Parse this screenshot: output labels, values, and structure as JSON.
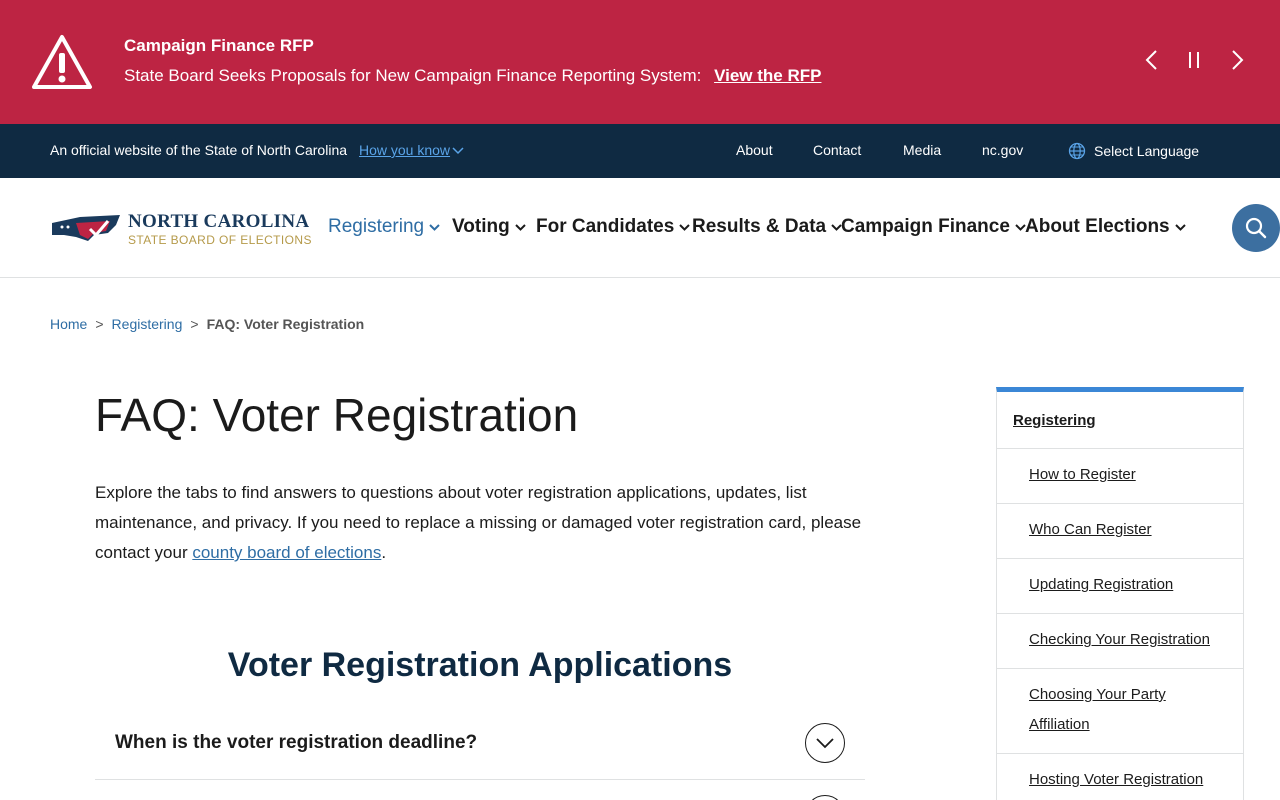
{
  "alert": {
    "title": "Campaign Finance RFP",
    "text": "State Board Seeks Proposals for New Campaign Finance Reporting System:",
    "link": "View the RFP"
  },
  "official_bar": {
    "text": "An official website of the State of North Carolina",
    "how_know": "How you know",
    "links": [
      "About",
      "Contact",
      "Media",
      "nc.gov"
    ],
    "language": "Select Language"
  },
  "header": {
    "logo_name": "NORTH CAROLINA",
    "logo_sub": "STATE BOARD OF ELECTIONS",
    "nav": [
      "Registering",
      "Voting",
      "For Candidates",
      "Results & Data",
      "Campaign Finance",
      "About Elections"
    ]
  },
  "breadcrumb": {
    "home": "Home",
    "parent": "Registering",
    "current": "FAQ: Voter Registration",
    "sep": ">"
  },
  "main": {
    "title": "FAQ: Voter Registration",
    "intro_before": "Explore the tabs to find answers to questions about voter registration applications, updates, list maintenance, and privacy. If you need to replace a missing or damaged voter registration card, please contact your ",
    "intro_link": "county board of elections",
    "intro_after": ".",
    "section_title": "Voter Registration Applications",
    "faq": [
      "When is the voter registration deadline?"
    ]
  },
  "sidenav": {
    "heading": "Registering",
    "items": [
      "How to Register",
      "Who Can Register",
      "Updating Registration",
      "Checking Your Registration",
      "Choosing Your Party Affiliation",
      "Hosting Voter Registration"
    ]
  },
  "colors": {
    "alert_bg": "#bd2443",
    "official_bg": "#0f2a42",
    "link": "#2e6da4",
    "accent": "#3b87d6",
    "search_bg": "#3c6fa0"
  }
}
